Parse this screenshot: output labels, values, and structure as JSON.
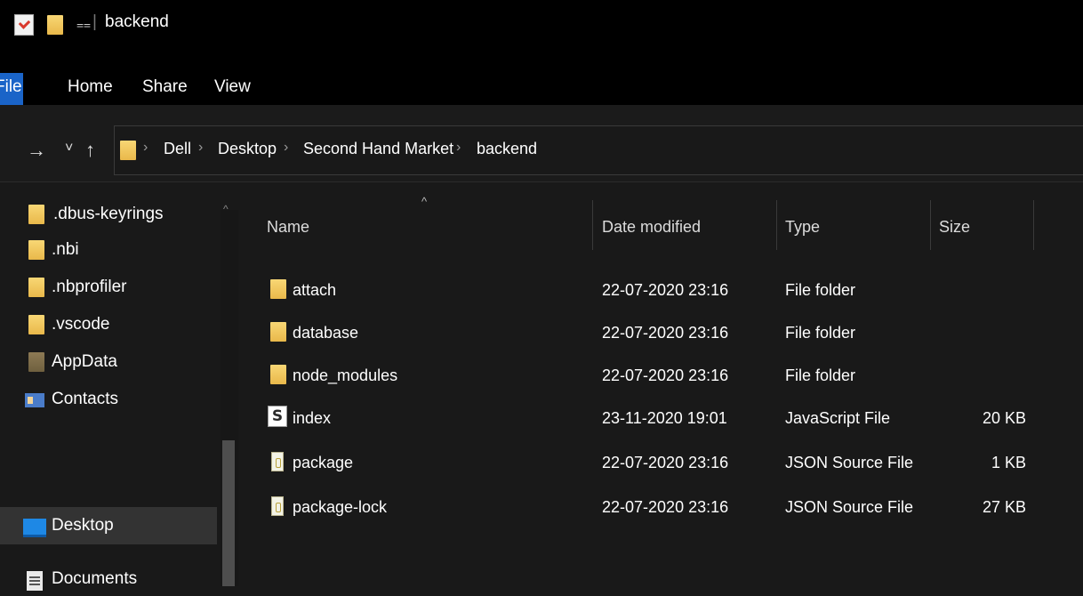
{
  "window": {
    "title": "backend",
    "qat_separator": "|",
    "dropdown_glyph": "⩵"
  },
  "ribbon": {
    "tabs": [
      "File",
      "Home",
      "Share",
      "View"
    ]
  },
  "nav": {
    "forward": "→",
    "recent": "˅",
    "up": "↑",
    "breadcrumb": [
      "Dell",
      "Desktop",
      "Second Hand Market",
      "backend"
    ],
    "separator": "›"
  },
  "sidebar": {
    "items": [
      {
        "label": ".dbus-keyrings",
        "icon": "folder-icon"
      },
      {
        "label": ".nbi",
        "icon": "folder-icon"
      },
      {
        "label": ".nbprofiler",
        "icon": "folder-icon"
      },
      {
        "label": ".vscode",
        "icon": "folder-icon"
      },
      {
        "label": "AppData",
        "icon": "folder-dark-icon"
      },
      {
        "label": "Contacts",
        "icon": "contacts-icon"
      },
      {
        "label": "Desktop",
        "icon": "desktop-icon",
        "selected": true
      },
      {
        "label": "Documents",
        "icon": "documents-icon"
      }
    ]
  },
  "columns": {
    "name": "Name",
    "date": "Date modified",
    "type": "Type",
    "size": "Size"
  },
  "files": [
    {
      "name": "attach",
      "date": "22-07-2020 23:16",
      "type": "File folder",
      "size": "",
      "icon": "folder-icon"
    },
    {
      "name": "database",
      "date": "22-07-2020 23:16",
      "type": "File folder",
      "size": "",
      "icon": "folder-icon"
    },
    {
      "name": "node_modules",
      "date": "22-07-2020 23:16",
      "type": "File folder",
      "size": "",
      "icon": "folder-icon"
    },
    {
      "name": "index",
      "date": "23-11-2020 19:01",
      "type": "JavaScript File",
      "size": "20 KB",
      "icon": "js-file-icon"
    },
    {
      "name": "package",
      "date": "22-07-2020 23:16",
      "type": "JSON Source File",
      "size": "1 KB",
      "icon": "json-file-icon"
    },
    {
      "name": "package-lock",
      "date": "22-07-2020 23:16",
      "type": "JSON Source File",
      "size": "27 KB",
      "icon": "json-file-icon"
    }
  ]
}
